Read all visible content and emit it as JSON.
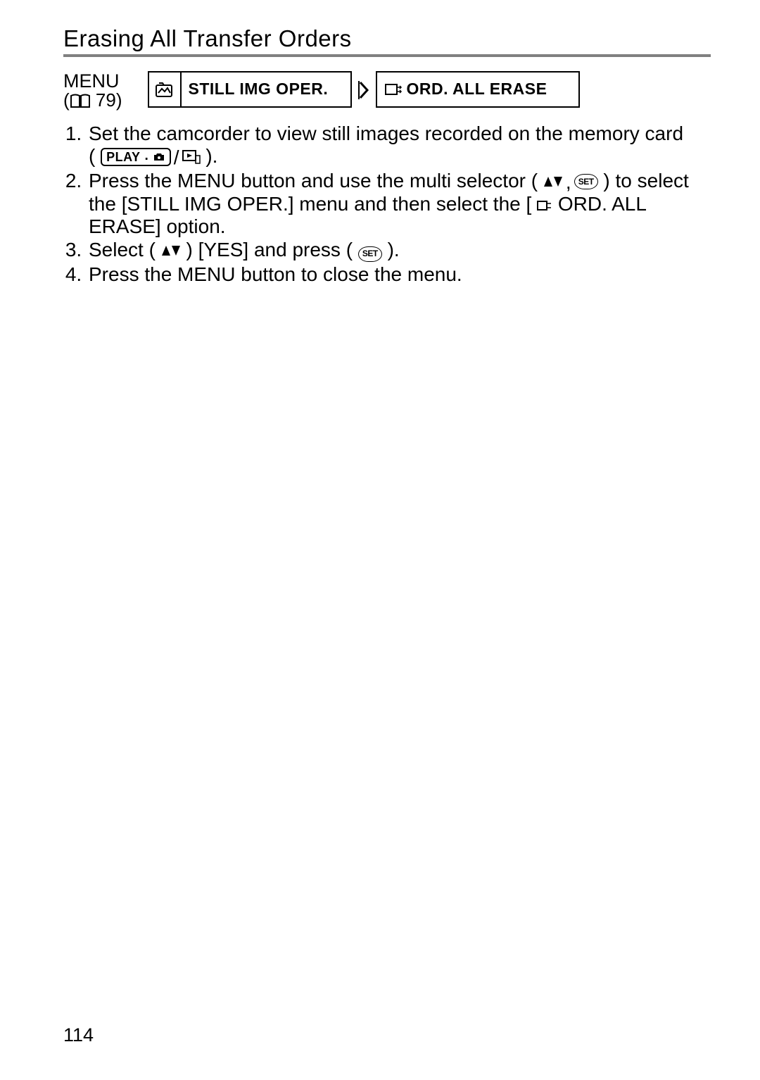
{
  "header": {
    "title": "Erasing All Transfer Orders"
  },
  "nav": {
    "menu_label": "MENU",
    "menu_ref": "79",
    "box1": "STILL IMG OPER.",
    "box2": "ORD. ALL ERASE"
  },
  "icons": {
    "book": "book-icon",
    "image_tools": "image-tools-icon",
    "right_arrow": "chevron-right-icon",
    "transfer_order": "transfer-order-icon",
    "camera": "camera-icon",
    "play_label": "PLAY",
    "play_cam": "play-camera-icon",
    "updown": "updown-icon",
    "set": "SET"
  },
  "steps": {
    "s1a": "Set the camcorder to view still images recorded on the memory card",
    "s1b_open": "( ",
    "s1b_close": " ).",
    "s2a": "Press the MENU button and use the multi selector (",
    "s2b": ") to select the [STILL IMG OPER.] menu and then select the [",
    "s2c": "ORD. ALL ERASE] option.",
    "s3a": "Select (",
    "s3b": ") [YES] and press (",
    "s3c": ").",
    "s4": "Press the MENU button to close the menu."
  },
  "page_number": "114"
}
